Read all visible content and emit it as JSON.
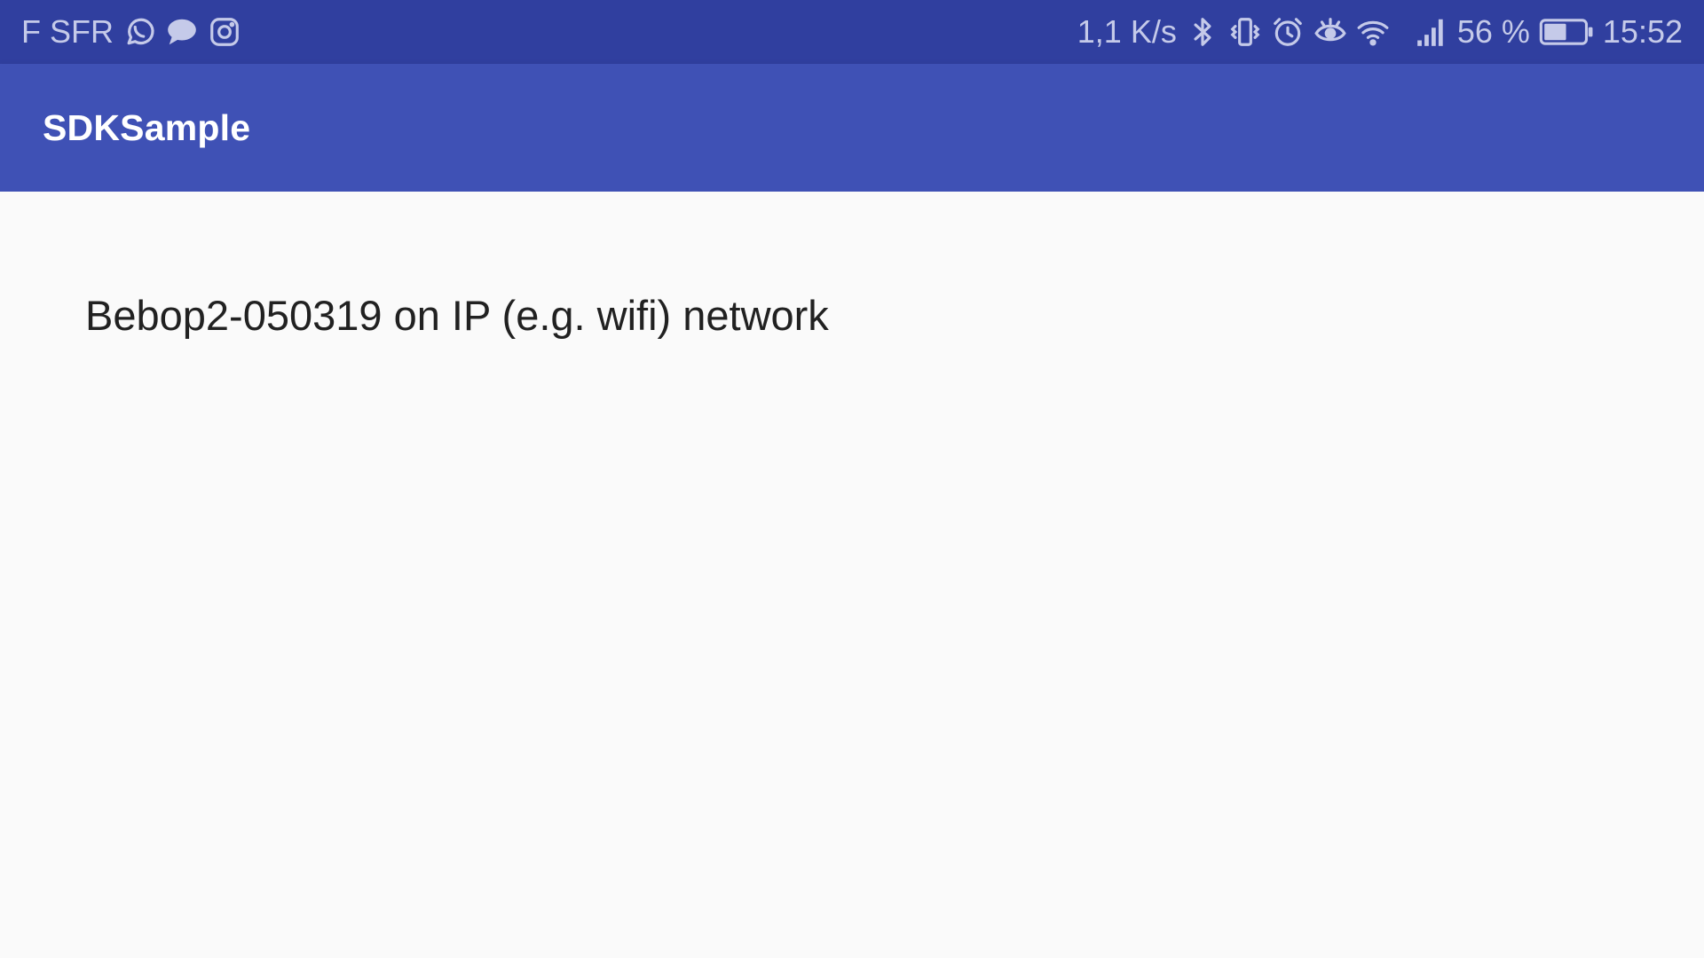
{
  "status_bar": {
    "carrier": "F SFR",
    "notification_icons": [
      "whatsapp-icon",
      "message-bubble-icon",
      "instagram-icon"
    ],
    "network_speed": "1,1 K/s",
    "system_icons": [
      "bluetooth-icon",
      "vibrate-icon",
      "alarm-icon",
      "eye-comfort-icon",
      "wifi-icon",
      "cell-signal-icon"
    ],
    "battery_percent": "56 %",
    "battery_level": 0.56,
    "time": "15:52",
    "colors": {
      "background": "#303f9f",
      "foreground": "#c5cae9"
    }
  },
  "app_bar": {
    "title": "SDKSample",
    "color": "#3f51b5"
  },
  "device_list": {
    "items": [
      {
        "label": "Bebop2-050319 on IP (e.g. wifi) network"
      }
    ]
  }
}
